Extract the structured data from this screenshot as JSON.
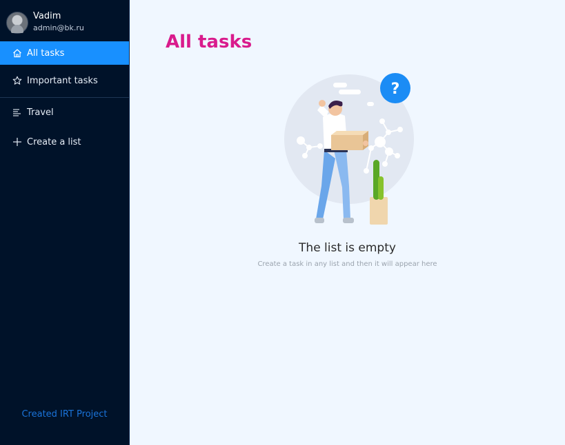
{
  "profile": {
    "name": "Vadim",
    "email": "admin@bk.ru"
  },
  "sidebar": {
    "items": [
      {
        "label": "All tasks",
        "icon": "home-icon",
        "active": true
      },
      {
        "label": "Important tasks",
        "icon": "star-icon",
        "active": false
      },
      {
        "label": "Travel",
        "icon": "list-lines-icon",
        "active": false
      },
      {
        "label": "Create a list",
        "icon": "plus-icon",
        "active": false
      }
    ],
    "footer": "Created IRT Project"
  },
  "main": {
    "title": "All tasks",
    "empty_title": "The list is empty",
    "empty_hint": "Create a task in any list and then it will appear here"
  },
  "colors": {
    "sidebar_bg": "#001229",
    "active_item_bg": "#1890ff",
    "title_accent": "#d91b8c",
    "main_bg": "#f0f7ff",
    "footer_link": "#1a73d9"
  }
}
